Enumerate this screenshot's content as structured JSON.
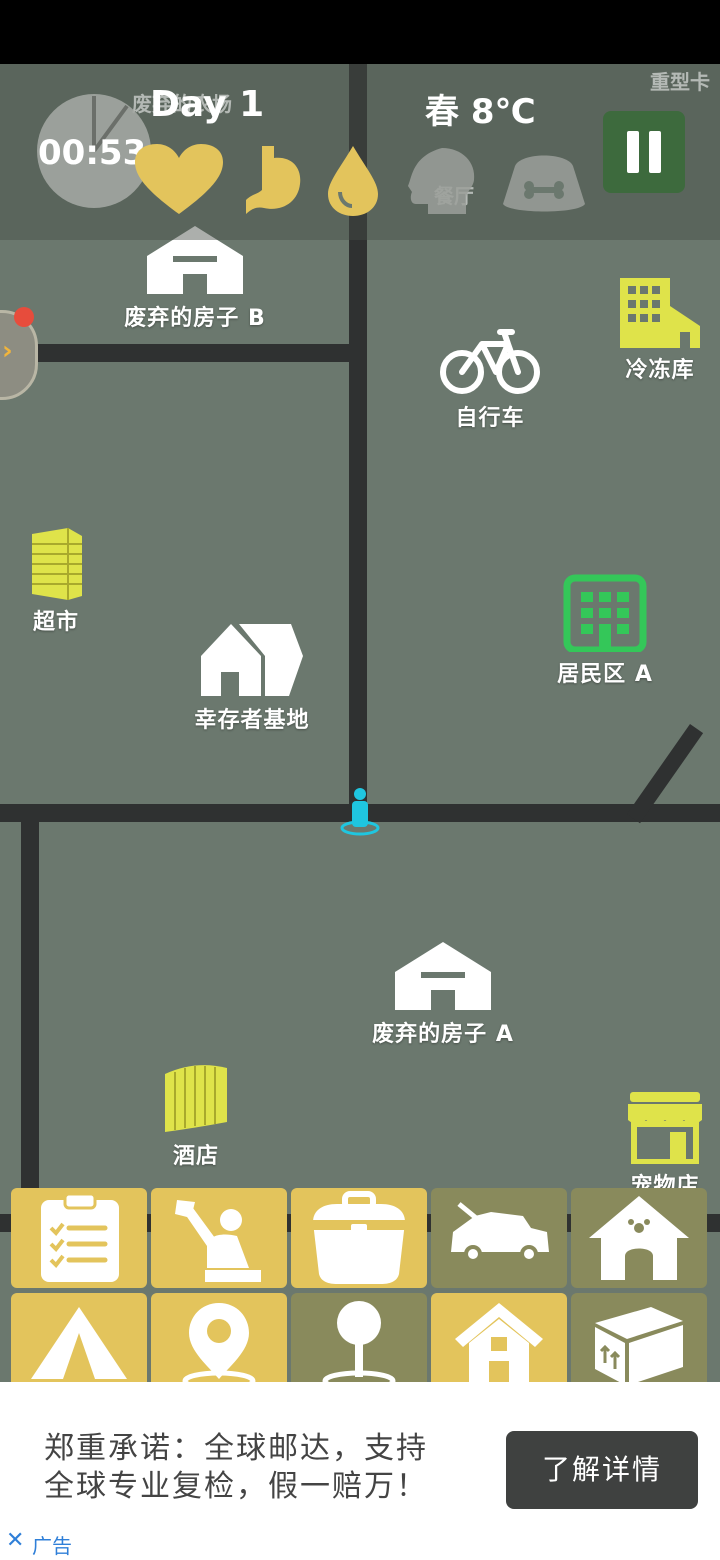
{
  "hud": {
    "day": "Day 1",
    "timer": "00:53",
    "season_temp": "春 8℃",
    "faded_labels": [
      "废弃的农场",
      "重型卡",
      "餐厅"
    ],
    "stat_icons": [
      "heart-icon",
      "stomach-icon",
      "water-drop-icon",
      "head-icon",
      "pet-bowl-icon"
    ]
  },
  "map": {
    "locations": {
      "house_b": "废弃的房子 B",
      "bicycle": "自行车",
      "cold_storage": "冷冻库",
      "supermarket": "超市",
      "survivor_base": "幸存者基地",
      "residential_a": "居民区 A",
      "house_a": "废弃的房子 A",
      "hotel": "酒店",
      "pet_store": "宠物店"
    }
  },
  "toolbar": {
    "row1": [
      "clipboard-icon",
      "crafting-icon",
      "backpack-icon",
      "car-icon",
      "pet-house-icon"
    ],
    "row2": [
      "tent-icon",
      "location-pin-icon",
      "map-marker-icon",
      "home-icon",
      "box-icon"
    ]
  },
  "ad": {
    "text_line1": "郑重承诺：全球邮达，支持",
    "text_line2": "全球专业复检，假一赔万！",
    "button": "了解详情",
    "close": "✕",
    "label": "广告"
  },
  "colors": {
    "map_bg": "#6b786e",
    "road": "#2f3131",
    "accent_yellow": "#e3c45c",
    "green": "#34c759",
    "player": "#1fc6e0"
  }
}
